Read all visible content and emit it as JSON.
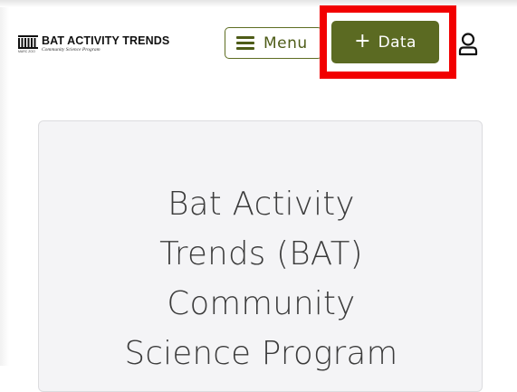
{
  "header": {
    "logo": {
      "title": "BAT ACTIVITY TRENDS",
      "subtitle": "Community Science Program",
      "tiny_text": "MARC ZOO"
    },
    "menu_button": {
      "label": "Menu",
      "icon": "hamburger-icon"
    },
    "data_button": {
      "label": "Data",
      "icon": "plus-icon"
    },
    "user_button": {
      "icon": "user-icon"
    }
  },
  "hero": {
    "title_line1": "Bat Activity",
    "title_line2": "Trends (BAT)",
    "title_line3": "Community",
    "title_line4": "Science Program"
  },
  "colors": {
    "brand_olive": "#5b6a22",
    "highlight_red": "#f20000",
    "card_bg": "#f4f4f6"
  }
}
